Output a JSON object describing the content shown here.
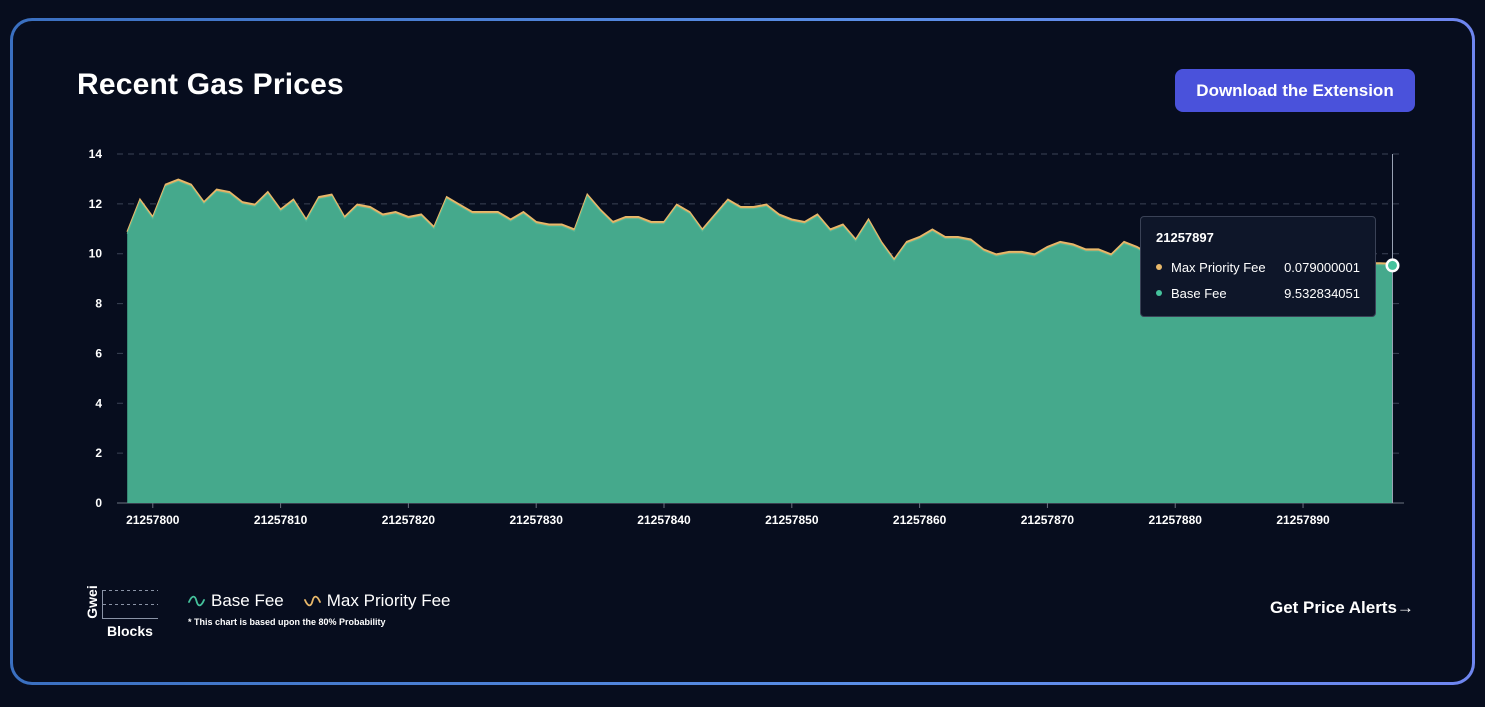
{
  "header": {
    "title": "Recent Gas Prices",
    "download_label": "Download the Extension"
  },
  "tooltip": {
    "block": "21257897",
    "rows": [
      {
        "label": "Max Priority Fee",
        "value": "0.079000001",
        "color": "#e8b86a"
      },
      {
        "label": "Base Fee",
        "value": "9.532834051",
        "color": "#45c29c"
      }
    ]
  },
  "legend": {
    "y_unit": "Gwei",
    "x_unit": "Blocks",
    "base_fee_label": "Base Fee",
    "priority_fee_label": "Max Priority Fee",
    "note": "* This chart is based upon the 80% Probability"
  },
  "footer": {
    "alerts_label": "Get Price Alerts→"
  },
  "colors": {
    "base_fee": "#45a98c",
    "priority_fee": "#e8b86a",
    "accent": "#4a52db",
    "background": "#070d1e"
  },
  "chart_data": {
    "type": "area",
    "stacked": true,
    "xlabel": "",
    "ylabel": "",
    "x_start": 21257798,
    "x_end": 21257897,
    "xlim": [
      21257797.2,
      21257897.9
    ],
    "ylim": [
      0,
      14
    ],
    "yticks": [
      0,
      2,
      4,
      6,
      8,
      10,
      12,
      14
    ],
    "xticks": [
      21257800,
      21257810,
      21257820,
      21257830,
      21257840,
      21257850,
      21257860,
      21257870,
      21257880,
      21257890
    ],
    "grid": true,
    "series": [
      {
        "name": "Base Fee",
        "values": [
          10.8,
          12.1,
          11.4,
          12.7,
          12.9,
          12.7,
          12.0,
          12.5,
          12.4,
          12.0,
          11.9,
          12.4,
          11.7,
          12.1,
          11.3,
          12.2,
          12.3,
          11.4,
          11.9,
          11.8,
          11.5,
          11.6,
          11.4,
          11.5,
          11.0,
          12.2,
          11.9,
          11.6,
          11.6,
          11.6,
          11.3,
          11.6,
          11.2,
          11.1,
          11.1,
          10.9,
          12.3,
          11.7,
          11.2,
          11.4,
          11.4,
          11.2,
          11.2,
          11.9,
          11.6,
          10.9,
          11.5,
          12.1,
          11.8,
          11.8,
          11.9,
          11.5,
          11.3,
          11.2,
          11.5,
          10.9,
          11.1,
          10.5,
          11.3,
          10.4,
          9.7,
          10.4,
          10.6,
          10.9,
          10.6,
          10.6,
          10.5,
          10.1,
          9.9,
          10.0,
          10.0,
          9.9,
          10.2,
          10.4,
          10.3,
          10.1,
          10.1,
          9.9,
          10.4,
          10.2,
          9.9,
          9.8,
          9.7,
          9.8,
          9.7,
          9.7,
          9.6,
          9.8,
          9.6,
          9.6,
          9.7,
          9.6,
          9.6,
          9.7,
          9.6,
          9.6,
          9.6,
          9.55,
          9.55,
          9.53
        ]
      },
      {
        "name": "Max Priority Fee",
        "values": [
          0.08,
          0.08,
          0.08,
          0.08,
          0.08,
          0.08,
          0.08,
          0.08,
          0.08,
          0.08,
          0.08,
          0.08,
          0.08,
          0.08,
          0.08,
          0.08,
          0.08,
          0.08,
          0.08,
          0.08,
          0.08,
          0.08,
          0.08,
          0.08,
          0.08,
          0.08,
          0.08,
          0.08,
          0.08,
          0.08,
          0.08,
          0.08,
          0.08,
          0.08,
          0.08,
          0.08,
          0.08,
          0.08,
          0.08,
          0.08,
          0.08,
          0.08,
          0.08,
          0.08,
          0.08,
          0.08,
          0.08,
          0.08,
          0.08,
          0.08,
          0.08,
          0.08,
          0.08,
          0.08,
          0.08,
          0.08,
          0.08,
          0.08,
          0.08,
          0.08,
          0.08,
          0.08,
          0.08,
          0.08,
          0.08,
          0.08,
          0.08,
          0.08,
          0.08,
          0.08,
          0.08,
          0.08,
          0.08,
          0.08,
          0.08,
          0.08,
          0.08,
          0.08,
          0.08,
          0.08,
          0.08,
          0.08,
          0.08,
          0.08,
          0.08,
          0.08,
          0.08,
          0.08,
          0.08,
          0.08,
          0.08,
          0.08,
          0.08,
          0.08,
          0.08,
          0.08,
          0.08,
          0.079,
          0.079,
          0.079
        ]
      }
    ],
    "hover_block": 21257897
  }
}
